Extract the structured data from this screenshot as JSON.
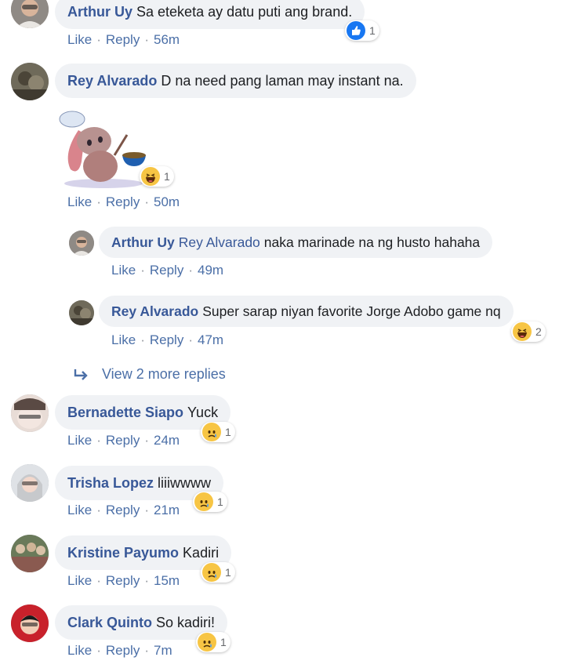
{
  "actions": {
    "like": "Like",
    "reply": "Reply"
  },
  "comments": [
    {
      "author": "Arthur Uy",
      "text": "Sa eteketa ay datu puti ang brand.",
      "time": "56m",
      "reaction": "like",
      "reaction_count": "1"
    },
    {
      "author": "Rey Alvarado",
      "text": "D na need pang laman may instant na.",
      "time": "50m",
      "reaction": "haha",
      "reaction_count": "1",
      "sticker": "chef-bunny-sticker"
    },
    {
      "author": "Arthur Uy",
      "mention": "Rey Alvarado",
      "text": "naka marinade na ng husto hahaha",
      "time": "49m"
    },
    {
      "author": "Rey Alvarado",
      "text": "Super sarap niyan favorite Jorge Adobo game nq",
      "time": "47m",
      "reaction": "haha",
      "reaction_count": "2"
    },
    {
      "author": "Bernadette Siapo",
      "text": "Yuck",
      "time": "24m",
      "reaction": "sad",
      "reaction_count": "1"
    },
    {
      "author": "Trisha Lopez",
      "text": "liiiwwww",
      "time": "21m",
      "reaction": "sad",
      "reaction_count": "1"
    },
    {
      "author": "Kristine Payumo",
      "text": "Kadiri",
      "time": "15m",
      "reaction": "sad",
      "reaction_count": "1"
    },
    {
      "author": "Clark Quinto",
      "text": "So kadiri!",
      "time": "7m",
      "reaction": "sad",
      "reaction_count": "1"
    }
  ],
  "view_more": "View 2 more replies",
  "colors": {
    "link": "#385898",
    "bubble": "#f0f2f5",
    "like": "#1877f2",
    "emoji": "#f7c544"
  }
}
